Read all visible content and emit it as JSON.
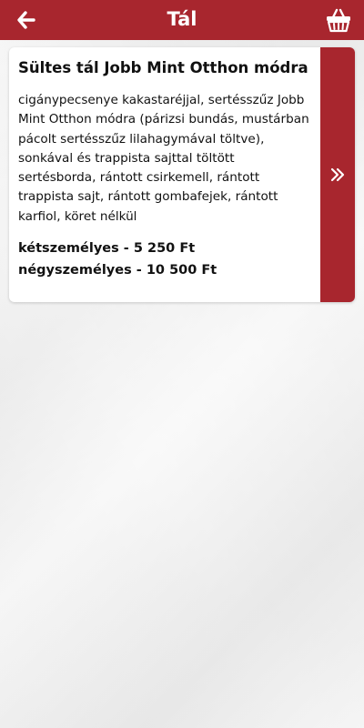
{
  "header": {
    "title": "Tál",
    "back_icon": "arrow-left-icon",
    "cart_icon": "basket-icon",
    "color": "#a8262e"
  },
  "item": {
    "title": "Sültes tál Jobb Mint Otthon módra",
    "description": "cigánypecsenye kakastaréjjal, sertésszűz Jobb Mint Otthon módra (párizsi bundás, mustárban pácolt sertésszűz lilahagymával töltve), sonkával és trappista sajttal töltött sertésborda, rántott csirkemell, rántott trappista sajt, rántott gombafejek, rántott karfiol, köret nélkül",
    "prices": [
      "kétszemélyes - 5 250 Ft",
      "négyszemélyes - 10 500 Ft"
    ],
    "detail_icon": "double-chevron-right-icon"
  }
}
